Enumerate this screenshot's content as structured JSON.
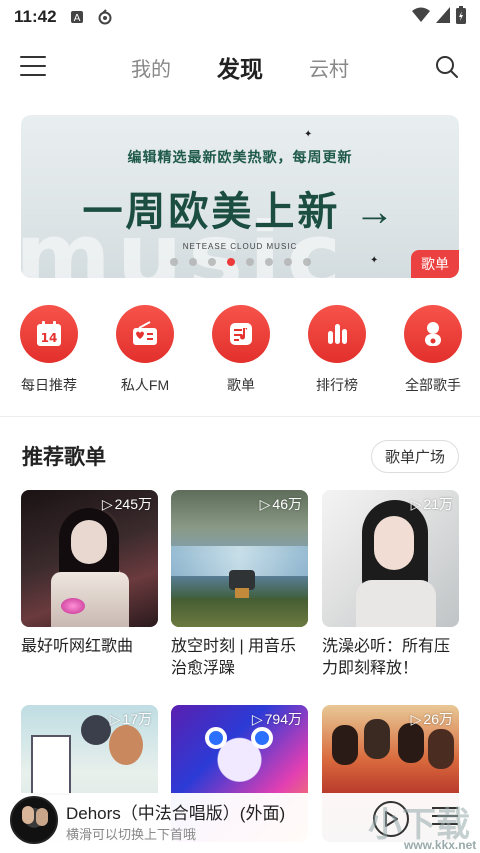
{
  "status_bar": {
    "time": "11:42"
  },
  "nav": {
    "tabs": [
      {
        "label": "我的"
      },
      {
        "label": "发现"
      },
      {
        "label": "云村"
      }
    ],
    "active_tab": "发现"
  },
  "banner": {
    "subtitle": "编辑精选最新欧美热歌，每周更新",
    "headline": "一周欧美上新 →",
    "background_word": "music",
    "brand": "NETEASE CLOUD MUSIC",
    "tag": "歌单",
    "dot_count": 8,
    "active_dot": 4
  },
  "quick_access": [
    {
      "label": "每日推荐",
      "icon": "calendar-icon",
      "badge": "14"
    },
    {
      "label": "私人FM",
      "icon": "radio-icon"
    },
    {
      "label": "歌单",
      "icon": "playlist-icon"
    },
    {
      "label": "排行榜",
      "icon": "chart-bars-icon"
    },
    {
      "label": "全部歌手",
      "icon": "singer-icon"
    }
  ],
  "section": {
    "title": "推荐歌单",
    "more_label": "歌单广场"
  },
  "playlists": [
    {
      "title": "最好听网红歌曲",
      "plays": "245万"
    },
    {
      "title": "放空时刻 | 用音乐治愈浮躁",
      "plays": "46万"
    },
    {
      "title": "洗澡必听：所有压力即刻释放！",
      "plays": "21万"
    },
    {
      "title": "",
      "plays": "17万"
    },
    {
      "title": "",
      "plays": "794万"
    },
    {
      "title": "",
      "plays": "26万"
    }
  ],
  "player": {
    "song": "Dehors（中法合唱版）(外面)",
    "hint": "横滑可以切换上下首哦"
  },
  "watermark": "www.kkx.net",
  "colors": {
    "accent": "#ec4141",
    "banner_text": "#1b4d40"
  }
}
